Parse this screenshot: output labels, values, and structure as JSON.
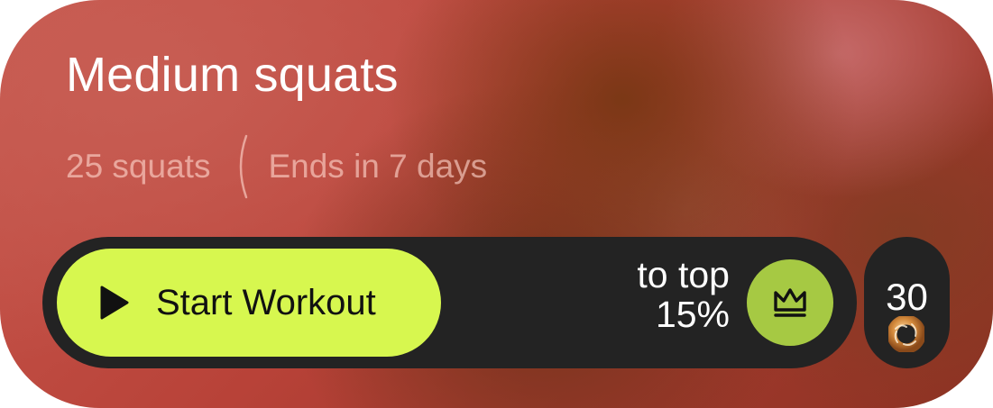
{
  "challenge": {
    "title": "Medium squats",
    "goal": "25 squats",
    "ends": "Ends in 7 days"
  },
  "actions": {
    "start_label": "Start Workout",
    "start_icon": "play-icon"
  },
  "ranking": {
    "line1": "to top",
    "percentile": "15%",
    "icon": "crown-icon"
  },
  "rewards": {
    "count": "30",
    "icon": "donut-coin-icon"
  },
  "colors": {
    "accent": "#d7f74f",
    "crown_badge": "#a6c943",
    "bar": "#232323"
  }
}
